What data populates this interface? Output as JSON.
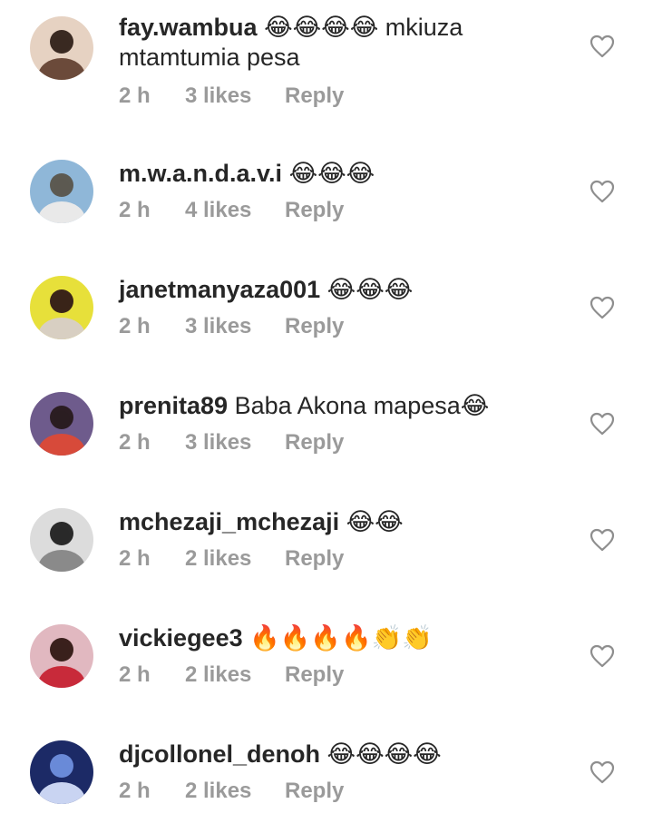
{
  "comments": [
    {
      "username": "fay.wambua",
      "text": "😂😂😂😂 mkiuza mtamtumia pesa",
      "time": "2 h",
      "likes": "3 likes",
      "reply": "Reply",
      "avatar_colors": [
        "#e6d2c2",
        "#3a2a22",
        "#6b4a3a"
      ]
    },
    {
      "username": "m.w.a.n.d.a.v.i",
      "text": "😂😂😂",
      "time": "2 h",
      "likes": "4 likes",
      "reply": "Reply",
      "avatar_colors": [
        "#8fb7d8",
        "#5c5a52",
        "#e9e9e9"
      ]
    },
    {
      "username": "janetmanyaza001",
      "text": "😂😂😂",
      "time": "2 h",
      "likes": "3 likes",
      "reply": "Reply",
      "avatar_colors": [
        "#e7e03a",
        "#3a2418",
        "#d8cfc2"
      ]
    },
    {
      "username": "prenita89",
      "text": "Baba Akona mapesa😂",
      "time": "2 h",
      "likes": "3 likes",
      "reply": "Reply",
      "avatar_colors": [
        "#6e5b8c",
        "#2b1d22",
        "#d74a3a"
      ]
    },
    {
      "username": "mchezaji_mchezaji",
      "text": "😂😂",
      "time": "2 h",
      "likes": "2 likes",
      "reply": "Reply",
      "avatar_colors": [
        "#dcdcdc",
        "#2a2a2a",
        "#8a8a8a"
      ]
    },
    {
      "username": "vickiegee3",
      "text": "🔥🔥🔥🔥👏👏",
      "time": "2 h",
      "likes": "2 likes",
      "reply": "Reply",
      "avatar_colors": [
        "#e1b8c0",
        "#3a201c",
        "#c82a3a"
      ]
    },
    {
      "username": "djcollonel_denoh",
      "text": "😂😂😂😂",
      "time": "2 h",
      "likes": "2 likes",
      "reply": "Reply",
      "avatar_colors": [
        "#1c2a66",
        "#6a8ad8",
        "#c9d4f2"
      ]
    }
  ],
  "colors": {
    "meta": "#9a9a9a",
    "text": "#262626",
    "heart_stroke": "#8e8e8e"
  },
  "icons": {
    "heart": "heart-icon"
  }
}
